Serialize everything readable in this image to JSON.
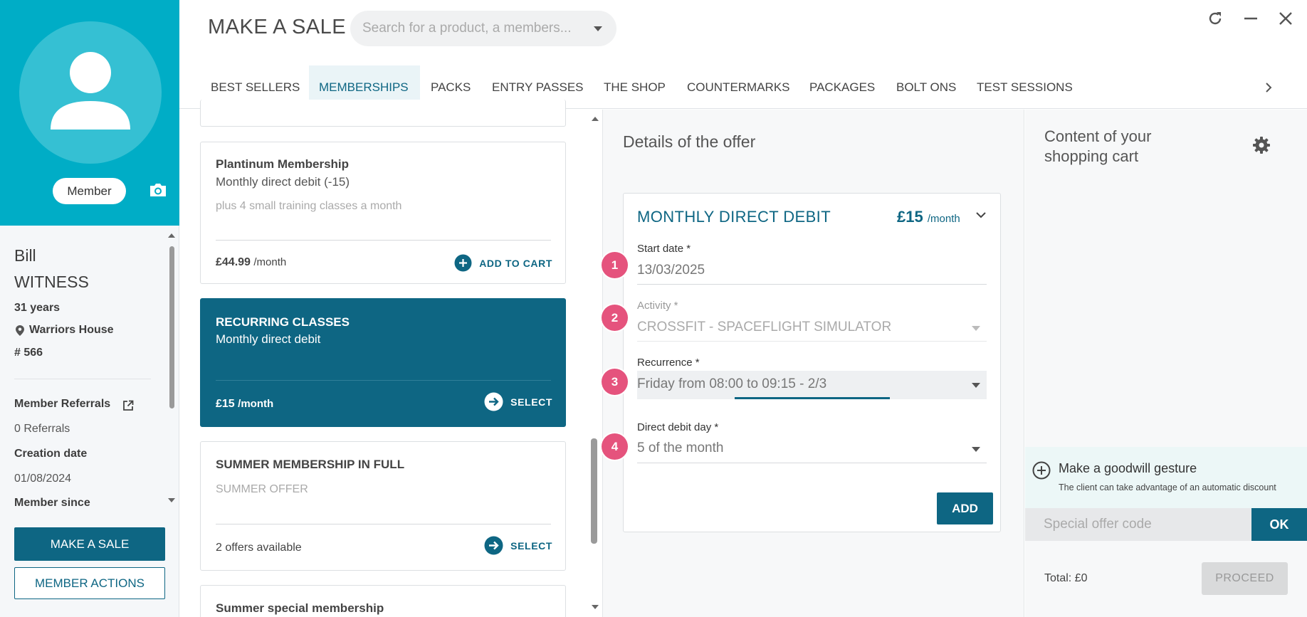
{
  "app": {
    "title": "MAKE A SALE",
    "search_placeholder": "Search for a product, a members..."
  },
  "window_controls": [
    "refresh-icon",
    "minimize-icon",
    "close-icon"
  ],
  "member": {
    "badge": "Member",
    "first_name": "Bill",
    "last_name": "WITNESS",
    "age": "31 years",
    "location": "Warriors House",
    "number": "# 566",
    "referrals_label": "Member Referrals",
    "referrals_count": "0 Referrals",
    "creation_label": "Creation date",
    "creation_date": "01/08/2024",
    "member_since_label": "Member since"
  },
  "sidebar_buttons": {
    "make_sale": "MAKE A SALE",
    "member_actions": "MEMBER ACTIONS"
  },
  "tabs": [
    {
      "label": "BEST SELLERS",
      "active": false
    },
    {
      "label": "MEMBERSHIPS",
      "active": true
    },
    {
      "label": "PACKS",
      "active": false
    },
    {
      "label": "ENTRY PASSES",
      "active": false
    },
    {
      "label": "THE SHOP",
      "active": false
    },
    {
      "label": "COUNTERMARKS",
      "active": false
    },
    {
      "label": "PACKAGES",
      "active": false
    },
    {
      "label": "BOLT ONS",
      "active": false
    },
    {
      "label": "TEST SESSIONS",
      "active": false
    }
  ],
  "offers": [
    {
      "title": "Plantinum Membership",
      "subtitle": "Monthly direct debit (-15)",
      "description": "plus 4 small training classes a month",
      "price": "£44.99",
      "price_unit": "/month",
      "action": "ADD TO CART"
    },
    {
      "title": "RECURRING CLASSES",
      "subtitle": "Monthly direct debit",
      "price": "£15",
      "price_unit": "/month",
      "action": "SELECT",
      "selected": true
    },
    {
      "title": "SUMMER MEMBERSHIP IN FULL",
      "description": "SUMMER OFFER",
      "footer": "2 offers available",
      "action": "SELECT"
    },
    {
      "title": "Summer special membership"
    }
  ],
  "details": {
    "title": "Details of the offer",
    "offer_name": "MONTHLY DIRECT DEBIT",
    "offer_price": "£15",
    "offer_price_unit": "/month",
    "fields": [
      {
        "step": "1",
        "label": "Start date *",
        "value": "13/03/2025"
      },
      {
        "step": "2",
        "label": "Activity *",
        "value": "CROSSFIT - SPACEFLIGHT SIMULATOR"
      },
      {
        "step": "3",
        "label": "Recurrence *",
        "value": "Friday from 08:00 to 09:15 - 2/3"
      },
      {
        "step": "4",
        "label": "Direct debit day *",
        "value": "5 of the month"
      }
    ],
    "add_button": "ADD"
  },
  "cart": {
    "title": "Content of your shopping cart",
    "goodwill_title": "Make a goodwill gesture",
    "goodwill_sub": "The client can take advantage of an automatic discount",
    "promo_placeholder": "Special offer code",
    "ok_button": "OK",
    "total": "Total: £0",
    "proceed_button": "PROCEED"
  },
  "colors": {
    "brand_teal": "#00adc6",
    "primary": "#0e6683",
    "step_badge": "#e5537d"
  }
}
